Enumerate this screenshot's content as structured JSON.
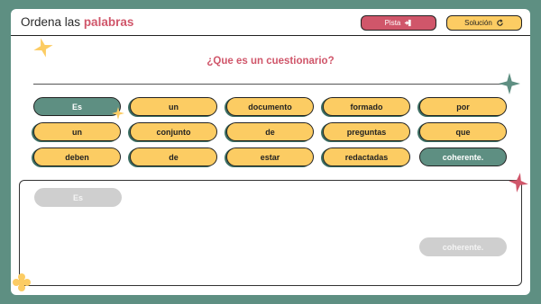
{
  "header": {
    "title_prefix": "Ordena las",
    "title_accent": "palabras",
    "pista_label": "Pista",
    "solucion_label": "Solución",
    "pista_icon": "hint-door-icon",
    "solucion_icon": "refresh-icon"
  },
  "question": "¿Que es un cuestionario?",
  "words": {
    "w1": "Es",
    "w2": "un",
    "w3": "documento",
    "w4": "formado",
    "w5": "por",
    "w6": "un",
    "w7": "conjunto",
    "w8": "de",
    "w9": "preguntas",
    "w10": "que",
    "w11": "deben",
    "w12": "de",
    "w13": "estar",
    "w14": "redactadas",
    "w15": "coherente."
  },
  "answer": {
    "first": "Es",
    "last": "coherente."
  },
  "colors": {
    "background": "#5e8f82",
    "chip": "#fccc63",
    "accent": "#d0566a",
    "selected_chip": "#5e8f82",
    "placeholder": "#cfcfcf"
  }
}
